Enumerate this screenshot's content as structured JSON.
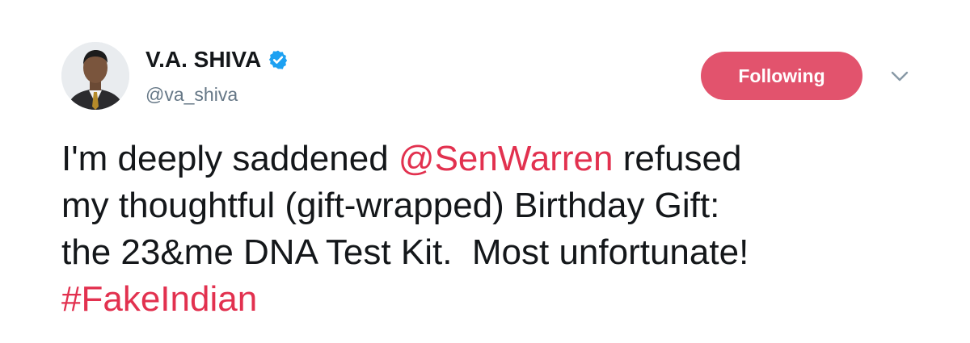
{
  "user": {
    "display_name": "V.A. SHIVA",
    "handle": "@va_shiva",
    "verified": true
  },
  "follow_button": {
    "label": "Following",
    "color": "#e2536d"
  },
  "menu": {
    "icon": "chevron-down-icon"
  },
  "tweet": {
    "text_part1": "I'm deeply saddened ",
    "mention": "@SenWarren",
    "text_part2": " refused\nmy thoughtful (gift-wrapped) Birthday Gift:\nthe 23&me DNA Test Kit.  Most unfortunate!\n",
    "hashtag": "#FakeIndian",
    "link_color": "#e2314f"
  }
}
